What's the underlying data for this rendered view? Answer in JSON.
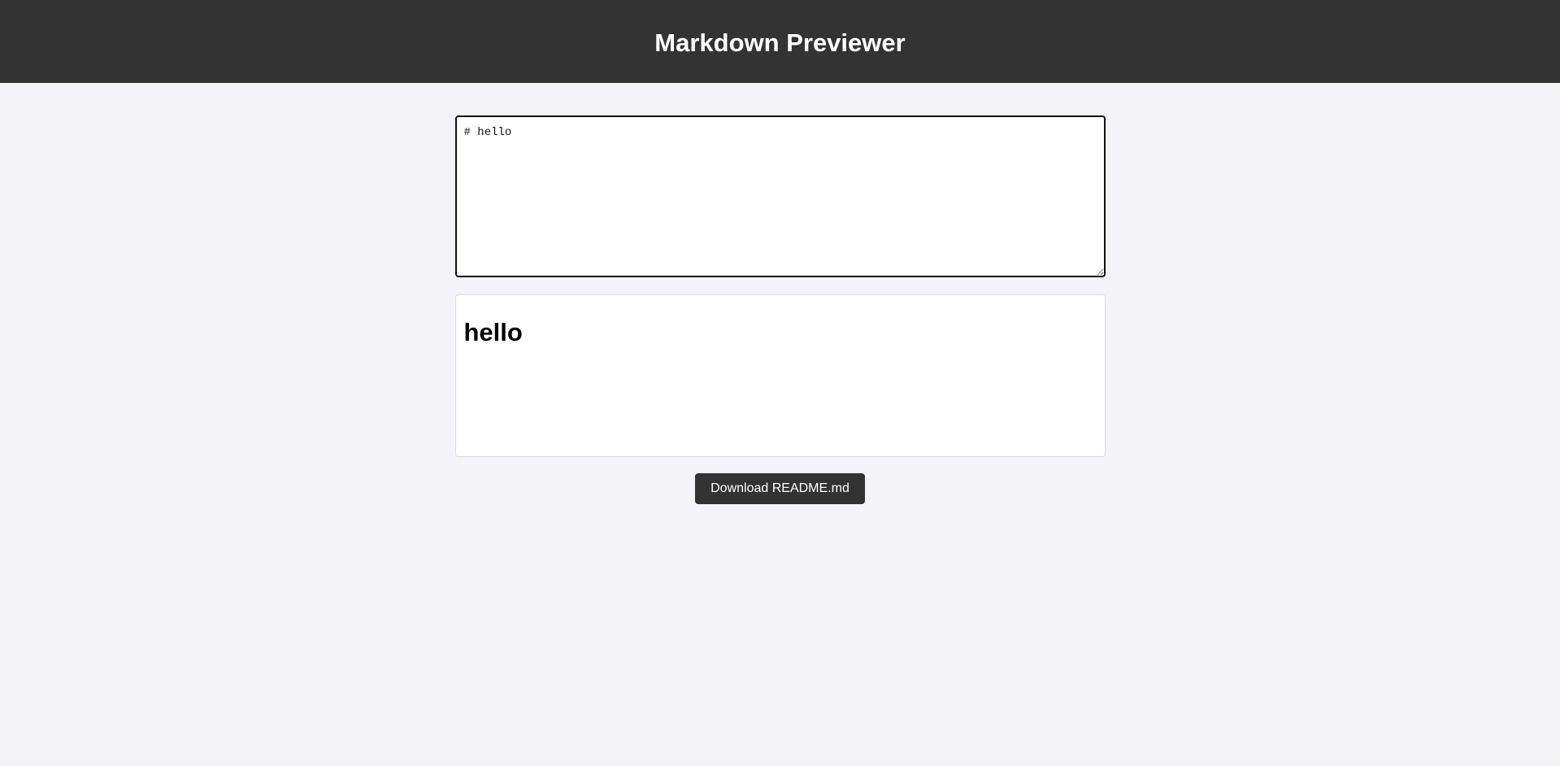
{
  "header": {
    "title": "Markdown Previewer"
  },
  "editor": {
    "value": "# hello",
    "placeholder": ""
  },
  "preview": {
    "heading": "hello"
  },
  "actions": {
    "download_label": "Download README.md"
  },
  "colors": {
    "header_bg": "#333333",
    "page_bg": "#f3f3f8",
    "button_bg": "#333333",
    "text_light": "#ffffff"
  }
}
